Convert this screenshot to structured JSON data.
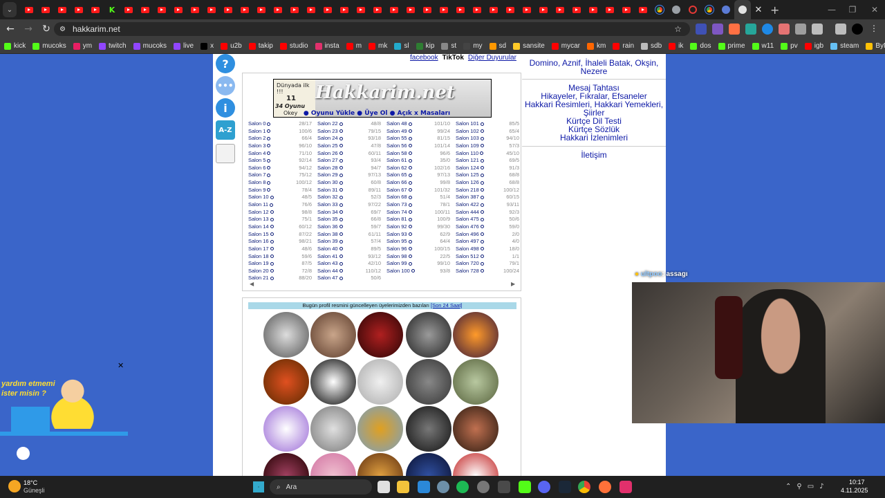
{
  "browser": {
    "url": "hakkarim.net",
    "tab_close": "✕",
    "new_tab": "+"
  },
  "bookmarks": [
    {
      "label": "kick",
      "color": "#53fc18"
    },
    {
      "label": "mucoks",
      "color": "#53fc18"
    },
    {
      "label": "ym",
      "color": "#e91e63"
    },
    {
      "label": "twitch",
      "color": "#9146ff"
    },
    {
      "label": "mucoks",
      "color": "#9146ff"
    },
    {
      "label": "live",
      "color": "#9146ff"
    },
    {
      "label": "x",
      "color": "#000000"
    },
    {
      "label": "u2b",
      "color": "#ff0000"
    },
    {
      "label": "takip",
      "color": "#ff0000"
    },
    {
      "label": "studio",
      "color": "#ff0000"
    },
    {
      "label": "insta",
      "color": "#e1306c"
    },
    {
      "label": "m",
      "color": "#ff0000"
    },
    {
      "label": "mk",
      "color": "#ff0000"
    },
    {
      "label": "sl",
      "color": "#22aacc"
    },
    {
      "label": "kip",
      "color": "#2e7d32"
    },
    {
      "label": "st",
      "color": "#888888"
    },
    {
      "label": "my",
      "color": "#444444"
    },
    {
      "label": "sd",
      "color": "#ff9800"
    },
    {
      "label": "sansite",
      "color": "#ffca28"
    },
    {
      "label": "mycar",
      "color": "#ff0000"
    },
    {
      "label": "km",
      "color": "#ff6600"
    },
    {
      "label": "rain",
      "color": "#ff0000"
    },
    {
      "label": "sdb",
      "color": "#bbbbbb"
    },
    {
      "label": "ik",
      "color": "#ff0000"
    },
    {
      "label": "dos",
      "color": "#53fc18"
    },
    {
      "label": "prime",
      "color": "#53fc18"
    },
    {
      "label": "w11",
      "color": "#53fc18"
    },
    {
      "label": "pv",
      "color": "#53fc18"
    },
    {
      "label": "igb",
      "color": "#ff0000"
    },
    {
      "label": "steam",
      "color": "#66c0f4"
    },
    {
      "label": "ByNo",
      "color": "#ffc107"
    }
  ],
  "site": {
    "social_facebook": "facebook",
    "social_tiktok": "TikTok",
    "announcements": "Diğer Duyurular",
    "logo_text": "Hakkarim.net",
    "logo_small_1": "Dünyada ilk !!!",
    "logo_small_2": "11",
    "logo_small_3": "34 Oyunu",
    "logo_small_4": "Okey",
    "banner_links": "● Oyunu Yükle  ● Üye Ol  ● Açık x Masaları",
    "profiles_heading": "Bugün profil resmini güncelleyen üyelerimizden bazıları",
    "profiles_link": "[Son 24 Saat]",
    "right_top_line": "Domino, Aznif, İhaleli Batak, Okşin, Nezere",
    "right_links": [
      "Mesaj Tahtası",
      "Hikayeler, Fıkralar, Efsaneler",
      "Hakkari Resimleri, Hakkari Yemekleri,",
      "Şiirler",
      "Kürtçe Dil Testi",
      "Kürtçe Sözlük",
      "Hakkari İzlenimleri"
    ],
    "contact": "İletişim",
    "salons": [
      [
        {
          "n": "Salon 0",
          "c": "28/17"
        },
        {
          "n": "Salon 1",
          "c": "100/6"
        },
        {
          "n": "Salon 2",
          "c": "66/4"
        },
        {
          "n": "Salon 3",
          "c": "96/10"
        },
        {
          "n": "Salon 4",
          "c": "71/10"
        },
        {
          "n": "Salon 5",
          "c": "92/14"
        },
        {
          "n": "Salon 6",
          "c": "94/12"
        },
        {
          "n": "Salon 7",
          "c": "75/12"
        },
        {
          "n": "Salon 8",
          "c": "100/12"
        },
        {
          "n": "Salon 9",
          "c": "78/4"
        },
        {
          "n": "Salon 10",
          "c": "48/5"
        },
        {
          "n": "Salon 11",
          "c": "76/6"
        },
        {
          "n": "Salon 12",
          "c": "98/8"
        },
        {
          "n": "Salon 13",
          "c": "75/1"
        },
        {
          "n": "Salon 14",
          "c": "60/12"
        },
        {
          "n": "Salon 15",
          "c": "87/22"
        },
        {
          "n": "Salon 16",
          "c": "98/21"
        },
        {
          "n": "Salon 17",
          "c": "48/6"
        },
        {
          "n": "Salon 18",
          "c": "59/6"
        },
        {
          "n": "Salon 19",
          "c": "87/5"
        },
        {
          "n": "Salon 20",
          "c": "72/8"
        },
        {
          "n": "Salon 21",
          "c": "88/20"
        }
      ],
      [
        {
          "n": "Salon 22",
          "c": "48/8"
        },
        {
          "n": "Salon 23",
          "c": "79/15"
        },
        {
          "n": "Salon 24",
          "c": "93/18"
        },
        {
          "n": "Salon 25",
          "c": "47/8"
        },
        {
          "n": "Salon 26",
          "c": "60/11"
        },
        {
          "n": "Salon 27",
          "c": "93/4"
        },
        {
          "n": "Salon 28",
          "c": "94/7"
        },
        {
          "n": "Salon 29",
          "c": "97/13"
        },
        {
          "n": "Salon 30",
          "c": "60/8"
        },
        {
          "n": "Salon 31",
          "c": "89/11"
        },
        {
          "n": "Salon 32",
          "c": "52/3"
        },
        {
          "n": "Salon 33",
          "c": "97/22"
        },
        {
          "n": "Salon 34",
          "c": "69/7"
        },
        {
          "n": "Salon 35",
          "c": "66/8"
        },
        {
          "n": "Salon 36",
          "c": "59/7"
        },
        {
          "n": "Salon 38",
          "c": "61/11"
        },
        {
          "n": "Salon 39",
          "c": "57/4"
        },
        {
          "n": "Salon 40",
          "c": "89/5"
        },
        {
          "n": "Salon 41",
          "c": "93/12"
        },
        {
          "n": "Salon 43",
          "c": "42/10"
        },
        {
          "n": "Salon 44",
          "c": "110/12"
        },
        {
          "n": "Salon 47",
          "c": "50/6"
        }
      ],
      [
        {
          "n": "Salon 48",
          "c": "101/10"
        },
        {
          "n": "Salon 49",
          "c": "99/24"
        },
        {
          "n": "Salon 55",
          "c": "81/15"
        },
        {
          "n": "Salon 56",
          "c": "101/14"
        },
        {
          "n": "Salon 58",
          "c": "96/6"
        },
        {
          "n": "Salon 61",
          "c": "35/0"
        },
        {
          "n": "Salon 62",
          "c": "102/16"
        },
        {
          "n": "Salon 65",
          "c": "97/13"
        },
        {
          "n": "Salon 66",
          "c": "99/8"
        },
        {
          "n": "Salon 67",
          "c": "101/32"
        },
        {
          "n": "Salon 68",
          "c": "51/4"
        },
        {
          "n": "Salon 73",
          "c": "78/1"
        },
        {
          "n": "Salon 74",
          "c": "100/11"
        },
        {
          "n": "Salon 81",
          "c": "100/9"
        },
        {
          "n": "Salon 92",
          "c": "99/30"
        },
        {
          "n": "Salon 93",
          "c": "62/9"
        },
        {
          "n": "Salon 95",
          "c": "64/4"
        },
        {
          "n": "Salon 96",
          "c": "100/15"
        },
        {
          "n": "Salon 98",
          "c": "22/5"
        },
        {
          "n": "Salon 99",
          "c": "99/10"
        },
        {
          "n": "Salon 100",
          "c": "93/8"
        }
      ],
      [
        {
          "n": "Salon 101",
          "c": "85/5"
        },
        {
          "n": "Salon 102",
          "c": "65/4"
        },
        {
          "n": "Salon 103",
          "c": "94/10"
        },
        {
          "n": "Salon 109",
          "c": "57/3"
        },
        {
          "n": "Salon 110",
          "c": "45/10"
        },
        {
          "n": "Salon 121",
          "c": "69/5"
        },
        {
          "n": "Salon 124",
          "c": "91/3"
        },
        {
          "n": "Salon 125",
          "c": "68/8"
        },
        {
          "n": "Salon 126",
          "c": "68/8"
        },
        {
          "n": "Salon 218",
          "c": "100/12"
        },
        {
          "n": "Salon 387",
          "c": "60/15"
        },
        {
          "n": "Salon 422",
          "c": "93/11"
        },
        {
          "n": "Salon 444",
          "c": "92/3"
        },
        {
          "n": "Salon 475",
          "c": "50/6"
        },
        {
          "n": "Salon 476",
          "c": "59/0"
        },
        {
          "n": "Salon 496",
          "c": "2/0"
        },
        {
          "n": "Salon 497",
          "c": "4/0"
        },
        {
          "n": "Salon 498",
          "c": "18/0"
        },
        {
          "n": "Salon 512",
          "c": "1/1"
        },
        {
          "n": "Salon 720",
          "c": "79/1"
        },
        {
          "n": "Salon 728",
          "c": "100/24"
        }
      ]
    ]
  },
  "overlay": {
    "chat_user": "ultpoo",
    "chat_text": ": assagı",
    "helper_text_1": "yardım etmemi",
    "helper_text_2": "ister misin ?",
    "helper_close": "✕"
  },
  "taskbar": {
    "weather_temp": "18°C",
    "weather_desc": "Güneşli",
    "search": "Ara",
    "time": "10:17",
    "date": "4.11.2025"
  }
}
